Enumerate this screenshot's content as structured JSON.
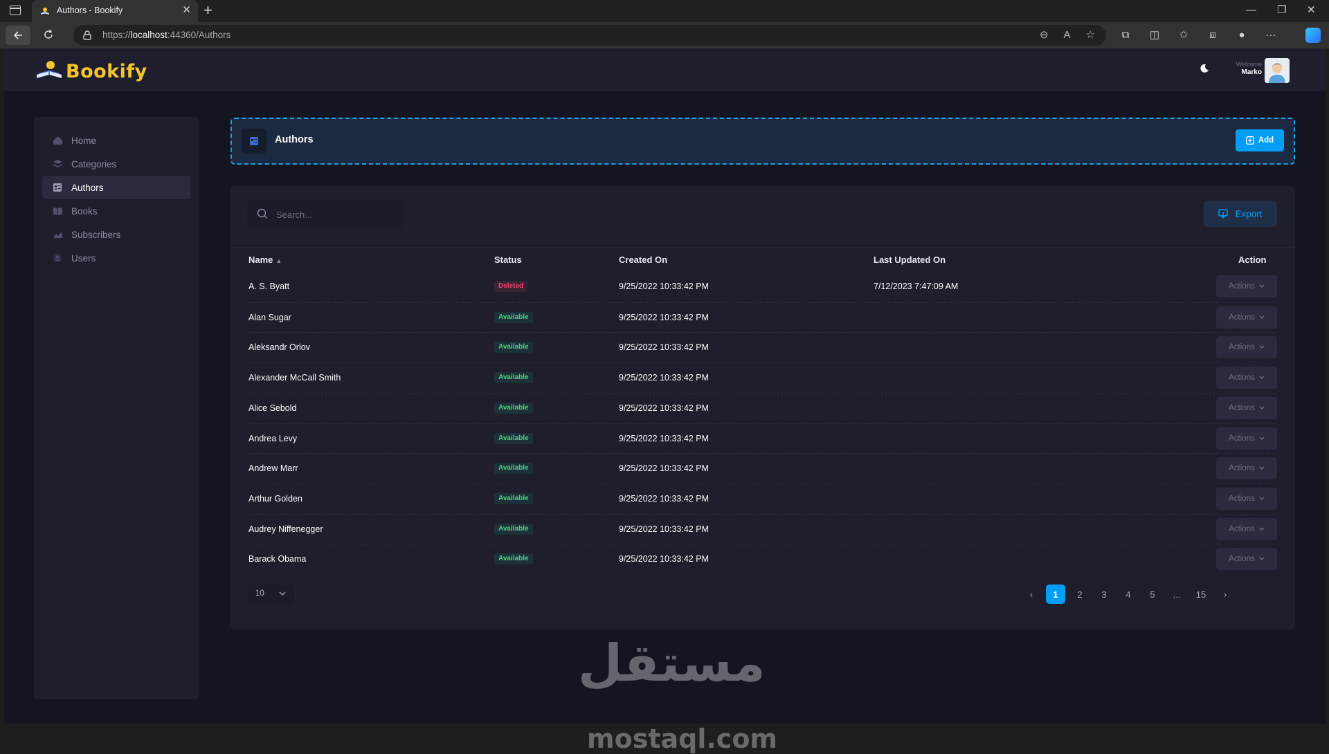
{
  "browser": {
    "tab_title": "Authors - Bookify",
    "url_prefix": "https://",
    "url_host": "localhost",
    "url_rest": ":44360/Authors"
  },
  "app": {
    "brand": "Bookify",
    "welcome_label": "Welcome",
    "user_name": "Marko"
  },
  "sidebar": {
    "items": [
      {
        "label": "Home",
        "icon": "home-icon"
      },
      {
        "label": "Categories",
        "icon": "categories-icon"
      },
      {
        "label": "Authors",
        "icon": "authors-icon",
        "active": true
      },
      {
        "label": "Books",
        "icon": "books-icon"
      },
      {
        "label": "Subscribers",
        "icon": "subscribers-icon"
      },
      {
        "label": "Users",
        "icon": "users-icon"
      }
    ]
  },
  "toolbar": {
    "title": "Authors",
    "add_label": "Add"
  },
  "table": {
    "search_placeholder": "Search...",
    "export_label": "Export",
    "columns": {
      "name": "Name",
      "status": "Status",
      "created": "Created On",
      "updated": "Last Updated On",
      "action": "Action"
    },
    "actions_label": "Actions",
    "rows": [
      {
        "name": "A. S. Byatt",
        "status": "Deleted",
        "created": "9/25/2022 10:33:42 PM",
        "updated": "7/12/2023 7:47:09 AM"
      },
      {
        "name": "Alan Sugar",
        "status": "Available",
        "created": "9/25/2022 10:33:42 PM",
        "updated": ""
      },
      {
        "name": "Aleksandr Orlov",
        "status": "Available",
        "created": "9/25/2022 10:33:42 PM",
        "updated": ""
      },
      {
        "name": "Alexander McCall Smith",
        "status": "Available",
        "created": "9/25/2022 10:33:42 PM",
        "updated": ""
      },
      {
        "name": "Alice Sebold",
        "status": "Available",
        "created": "9/25/2022 10:33:42 PM",
        "updated": ""
      },
      {
        "name": "Andrea Levy",
        "status": "Available",
        "created": "9/25/2022 10:33:42 PM",
        "updated": ""
      },
      {
        "name": "Andrew Marr",
        "status": "Available",
        "created": "9/25/2022 10:33:42 PM",
        "updated": ""
      },
      {
        "name": "Arthur Golden",
        "status": "Available",
        "created": "9/25/2022 10:33:42 PM",
        "updated": ""
      },
      {
        "name": "Audrey Niffenegger",
        "status": "Available",
        "created": "9/25/2022 10:33:42 PM",
        "updated": ""
      },
      {
        "name": "Barack Obama",
        "status": "Available",
        "created": "9/25/2022 10:33:42 PM",
        "updated": ""
      }
    ],
    "page_size": "10",
    "pages": [
      "1",
      "2",
      "3",
      "4",
      "5",
      "...",
      "15"
    ],
    "current_page": "1"
  },
  "watermark": {
    "arabic": "مستقل",
    "latin": "mostaql.com"
  },
  "colors": {
    "accent": "#009ef7",
    "brand": "#f5c52c",
    "available": "#50cd89",
    "deleted": "#f1416c"
  }
}
